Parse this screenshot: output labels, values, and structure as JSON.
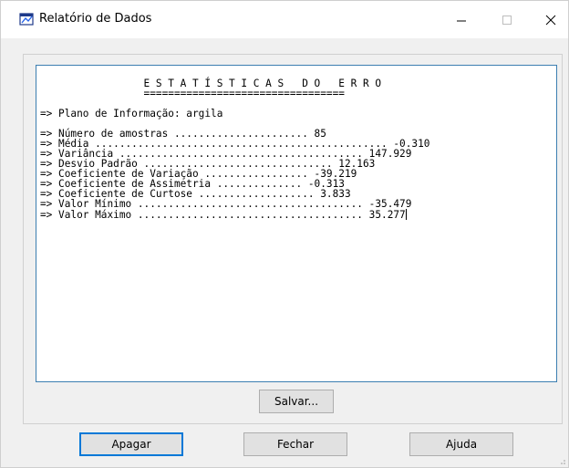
{
  "window": {
    "title": "Relatório de Dados",
    "controls": {
      "minimize": "—",
      "maximize": "☐",
      "close": "✕"
    }
  },
  "report": {
    "lines": [
      "                 E S T A T Í S T I C A S   D O   E R R O",
      "                 =================================",
      "",
      "=> Plano de Informação: argila",
      "",
      "=> Número de amostras ...................... 85",
      "=> Média ................................................ -0.310",
      "=> Variância ........................................ 147.929",
      "=> Desvio Padrão ............................... 12.163",
      "=> Coeficiente de Variação ................. -39.219",
      "=> Coeficiente de Assimetria .............. -0.313",
      "=> Coeficiente de Curtose ................... 3.833",
      "=> Valor Mínimo ..................................... -35.479",
      "=> Valor Máximo ..................................... 35.277"
    ]
  },
  "buttons": {
    "save": "Salvar...",
    "clear": "Apagar",
    "close": "Fechar",
    "help": "Ajuda"
  }
}
